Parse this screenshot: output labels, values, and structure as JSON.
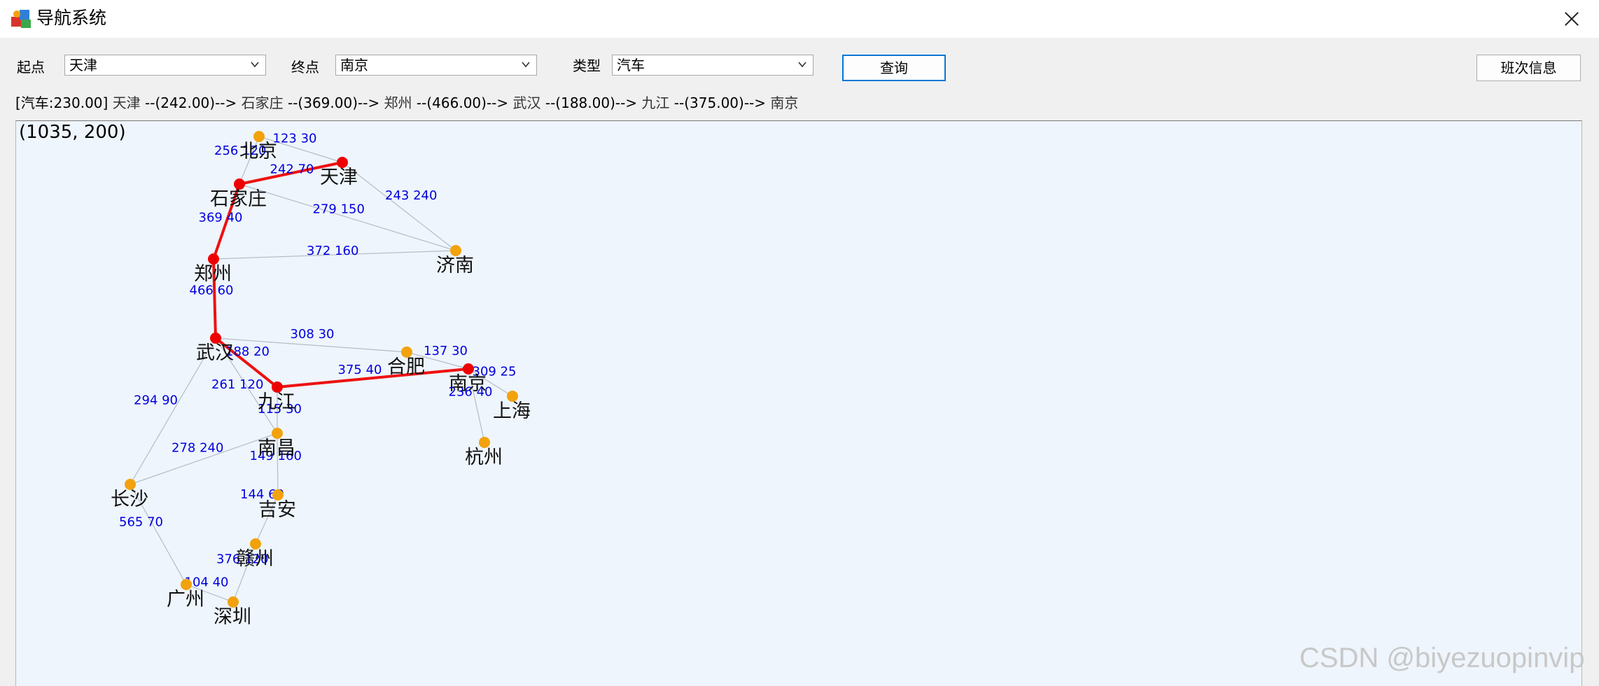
{
  "window": {
    "title": "导航系统"
  },
  "toolbar": {
    "start_label": "起点",
    "start_value": "天津",
    "end_label": "终点",
    "end_value": "南京",
    "type_label": "类型",
    "type_value": "汽车",
    "query_button": "查询",
    "schedule_button": "班次信息"
  },
  "result": {
    "summary": "[汽车:230.00]",
    "path": [
      {
        "city": "天津",
        "cost": "--(242.00)-->"
      },
      {
        "city": "石家庄",
        "cost": "--(369.00)-->"
      },
      {
        "city": "郑州",
        "cost": "--(466.00)-->"
      },
      {
        "city": "武汉",
        "cost": "--(188.00)-->"
      },
      {
        "city": "九江",
        "cost": "--(375.00)-->"
      },
      {
        "city": "南京",
        "cost": ""
      }
    ]
  },
  "map": {
    "coords_readout": "(1035, 200)",
    "colors": {
      "node": "#f2a20c",
      "path_node": "#ee0000",
      "path_edge": "#ee1111",
      "edge": "#b4bcc8",
      "edge_label": "#0000dd",
      "background": "#eef5fc"
    },
    "nodes": [
      {
        "id": "beijing",
        "name": "北京",
        "on_path": false
      },
      {
        "id": "tianjin",
        "name": "天津",
        "on_path": true
      },
      {
        "id": "shijiazhuang",
        "name": "石家庄",
        "on_path": true
      },
      {
        "id": "jinan",
        "name": "济南",
        "on_path": false
      },
      {
        "id": "zhengzhou",
        "name": "郑州",
        "on_path": true
      },
      {
        "id": "wuhan",
        "name": "武汉",
        "on_path": true
      },
      {
        "id": "hefei",
        "name": "合肥",
        "on_path": false
      },
      {
        "id": "nanjing",
        "name": "南京",
        "on_path": true
      },
      {
        "id": "shanghai",
        "name": "上海",
        "on_path": false
      },
      {
        "id": "hangzhou",
        "name": "杭州",
        "on_path": false
      },
      {
        "id": "jiujiang",
        "name": "九江",
        "on_path": true
      },
      {
        "id": "nanchang",
        "name": "南昌",
        "on_path": false
      },
      {
        "id": "changsha",
        "name": "长沙",
        "on_path": false
      },
      {
        "id": "jian",
        "name": "吉安",
        "on_path": false
      },
      {
        "id": "ganzhou",
        "name": "赣州",
        "on_path": false
      },
      {
        "id": "guangzhou",
        "name": "广州",
        "on_path": false
      },
      {
        "id": "shenzhen",
        "name": "深圳",
        "on_path": false
      }
    ],
    "edges": [
      {
        "from": "beijing",
        "to": "tianjin",
        "label": "123  30",
        "on_path": false
      },
      {
        "from": "beijing",
        "to": "shijiazhuang",
        "label": "256  120",
        "on_path": false
      },
      {
        "from": "tianjin",
        "to": "shijiazhuang",
        "label": "242  70",
        "on_path": true
      },
      {
        "from": "tianjin",
        "to": "jinan",
        "label": "243  240",
        "on_path": false
      },
      {
        "from": "shijiazhuang",
        "to": "jinan",
        "label": "279  150",
        "on_path": false
      },
      {
        "from": "shijiazhuang",
        "to": "zhengzhou",
        "label": "369  40",
        "on_path": true
      },
      {
        "from": "zhengzhou",
        "to": "jinan",
        "label": "372  160",
        "on_path": false
      },
      {
        "from": "zhengzhou",
        "to": "wuhan",
        "label": "466  60",
        "on_path": true
      },
      {
        "from": "wuhan",
        "to": "hefei",
        "label": "308  30",
        "on_path": false
      },
      {
        "from": "hefei",
        "to": "nanjing",
        "label": "137  30",
        "on_path": false
      },
      {
        "from": "wuhan",
        "to": "jiujiang",
        "label": "188  20",
        "on_path": true
      },
      {
        "from": "jiujiang",
        "to": "nanjing",
        "label": "375  40",
        "on_path": true
      },
      {
        "from": "nanjing",
        "to": "shanghai",
        "label": "309  25",
        "on_path": false
      },
      {
        "from": "nanjing",
        "to": "hangzhou",
        "label": "236  40",
        "on_path": false
      },
      {
        "from": "wuhan",
        "to": "nanchang",
        "label": "261  120",
        "on_path": false
      },
      {
        "from": "jiujiang",
        "to": "nanchang",
        "label": "115  30",
        "on_path": false
      },
      {
        "from": "wuhan",
        "to": "changsha",
        "label": "294  90",
        "on_path": false
      },
      {
        "from": "changsha",
        "to": "nanchang",
        "label": "278  240",
        "on_path": false
      },
      {
        "from": "nanchang",
        "to": "jian",
        "label": "149  160",
        "on_path": false
      },
      {
        "from": "jian",
        "to": "ganzhou",
        "label": "144  60",
        "on_path": false
      },
      {
        "from": "changsha",
        "to": "guangzhou",
        "label": "565  70",
        "on_path": false
      },
      {
        "from": "ganzhou",
        "to": "shenzhen",
        "label": "376  120",
        "on_path": false
      },
      {
        "from": "guangzhou",
        "to": "shenzhen",
        "label": "104  40",
        "on_path": false
      }
    ]
  },
  "watermark": "CSDN @biyezuopinvip"
}
